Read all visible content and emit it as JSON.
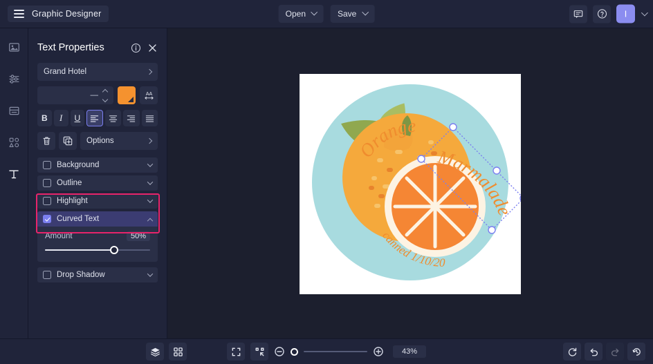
{
  "topbar": {
    "menu_icon": "hamburger-icon",
    "app_title": "Graphic Designer",
    "open_label": "Open",
    "save_label": "Save",
    "comment_icon": "comment-icon",
    "help_icon": "help-circle-icon",
    "avatar_initial": "I",
    "avatar_color": "#8b8df0"
  },
  "rail": {
    "items": [
      {
        "icon": "image-icon",
        "active": false
      },
      {
        "icon": "adjustments-icon",
        "active": false
      },
      {
        "icon": "layout-icon",
        "active": false
      },
      {
        "icon": "shapes-icon",
        "active": false
      },
      {
        "icon": "text-icon",
        "active": true
      }
    ]
  },
  "panel": {
    "title": "Text Properties",
    "info_icon": "info-circle-icon",
    "close_icon": "close-icon",
    "font_family": "Grand Hotel",
    "font_size_value": "—",
    "color_swatch": "#f5922f",
    "letter_spacing_icon": "letter-spacing-icon",
    "format_buttons": [
      {
        "name": "bold-button",
        "label": "B",
        "active": false
      },
      {
        "name": "italic-button",
        "label": "I",
        "active": false
      },
      {
        "name": "underline-button",
        "label": "U",
        "active": false
      },
      {
        "name": "align-left-button",
        "label": "align-left-icon",
        "active": true
      },
      {
        "name": "align-center-button",
        "label": "align-center-icon",
        "active": false
      },
      {
        "name": "align-right-button",
        "label": "align-right-icon",
        "active": false
      },
      {
        "name": "align-justify-button",
        "label": "align-justify-icon",
        "active": false
      }
    ],
    "delete_icon": "trash-icon",
    "duplicate_icon": "duplicate-icon",
    "options_label": "Options",
    "sections": [
      {
        "label": "Background",
        "checked": false,
        "open": false
      },
      {
        "label": "Outline",
        "checked": false,
        "open": false
      },
      {
        "label": "Highlight",
        "checked": false,
        "open": false
      },
      {
        "label": "Curved Text",
        "checked": true,
        "open": true,
        "highlighted": true
      },
      {
        "label": "Drop Shadow",
        "checked": false,
        "open": false
      }
    ],
    "curved_text": {
      "amount_label": "Amount",
      "amount_value": "50%",
      "slider_percent": 66
    },
    "highlight_color": "#e8246b"
  },
  "canvas": {
    "artwork_title": "Orange",
    "artwork_subtitle": "Marmalade",
    "artwork_footer": "canned 1/10/20",
    "background_circle_color": "#a8dbdf",
    "orange_color": "#f5a93c",
    "orange_slice_color": "#f58634",
    "leaf_color": "#8fa84b",
    "text_color": "#ef8c2e",
    "selection_color": "#7b7ff0",
    "selected_object": "Marmalade"
  },
  "bottombar": {
    "layers_icon": "layers-icon",
    "grid_icon": "grid-icon",
    "fit_icon": "fit-screen-icon",
    "shrink_icon": "shrink-icon",
    "zoom_out_icon": "zoom-out-icon",
    "zoom_in_icon": "zoom-in-icon",
    "zoom_value": "43%",
    "zoom_slider_percent": 6,
    "reset_icon": "reset-rotate-icon",
    "undo_icon": "undo-icon",
    "redo_icon": "redo-icon",
    "history_icon": "history-icon"
  }
}
